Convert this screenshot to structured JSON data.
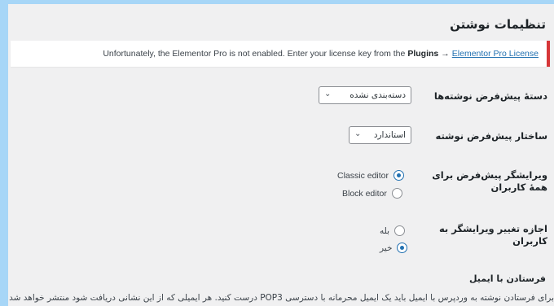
{
  "page": {
    "title": "تنظیمات نوشتن"
  },
  "notice": {
    "text_before": "Unfortunately, the Elementor Pro is not enabled. Enter your license key from the",
    "plugins_label": "Plugins",
    "arrow": "→",
    "link_label": "Elementor Pro License"
  },
  "default_category": {
    "label": "دستهٔ پیش‌فرض نوشته‌ها",
    "selected": "دسته‌بندی نشده"
  },
  "default_format": {
    "label": "ساختار پیش‌فرض نوشته",
    "selected": "استاندارد"
  },
  "default_editor": {
    "label": "ویرایشگر پیش‌فرض برای همهٔ کاربران",
    "options": [
      {
        "label": "Classic editor",
        "checked": true
      },
      {
        "label": "Block editor",
        "checked": false
      }
    ]
  },
  "allow_switch": {
    "label": "اجازه تغییر ویرایشگر به کاربران",
    "options": [
      {
        "label": "بله",
        "checked": false
      },
      {
        "label": "خیر",
        "checked": true
      }
    ]
  },
  "post_via_email": {
    "title": "فرستادن با ایمیل",
    "description": "برای فرستادن نوشته به وردپرس با ایمیل باید یک ایمیل محرمانه با دسترسی POP3 درست کنید. هر ایمیلی که از این نشانی دریافت شود منتشر خواهد شد."
  },
  "colors": {
    "accent": "#2271b1",
    "notice_border": "#d63638",
    "frame": "#a7d6f7"
  }
}
